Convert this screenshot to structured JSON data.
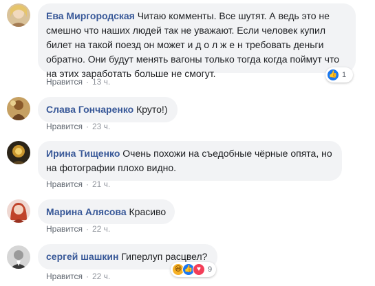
{
  "comments": [
    {
      "author": "Ева Миргородская",
      "text": "Читаю комменты. Все шутят. А ведь это не смешно что наших людей так не уважают. Если человек купил билет на такой поезд он может и д о л ж е н требовать деньги обратно. Они будут менять вагоны только тогда когда поймут что на этих заработать больше не смогут.",
      "like_label": "Нравится",
      "separator": "·",
      "time": "13 ч.",
      "reactions": {
        "icons": [
          "like-icon"
        ],
        "count": "1"
      }
    },
    {
      "author": "Слава Гончаренко",
      "text": "Круто!)",
      "like_label": "Нравится",
      "separator": "·",
      "time": "23 ч."
    },
    {
      "author": "Ирина Тищенко",
      "text": "Очень похожи на съедобные чёрные опята, но на фотографии плохо видно.",
      "like_label": "Нравится",
      "separator": "·",
      "time": "21 ч."
    },
    {
      "author": "Марина Алясова",
      "text": "Красиво",
      "like_label": "Нравится",
      "separator": "·",
      "time": "22 ч."
    },
    {
      "author": "сергей шашкин",
      "text": "Гиперлуп расцвел?",
      "like_label": "Нравится",
      "separator": "·",
      "time": "22 ч.",
      "reactions": {
        "icons": [
          "haha-icon",
          "like-icon",
          "love-icon"
        ],
        "count": "9"
      }
    }
  ],
  "colors": {
    "author": "#385898",
    "bubble": "#f2f3f5",
    "meta": "#90949c",
    "like_reaction": "#1877f2",
    "haha_reaction": "#f7b125",
    "love_reaction": "#f33e58"
  }
}
